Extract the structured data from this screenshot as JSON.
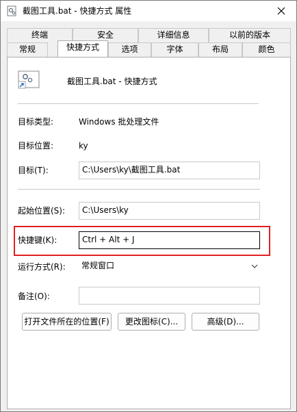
{
  "window": {
    "title": "截图工具.bat - 快捷方式 属性"
  },
  "tabs_row1": [
    "终端",
    "安全",
    "详细信息",
    "以前的版本"
  ],
  "tabs_row2": [
    "常规",
    "快捷方式",
    "选项",
    "字体",
    "布局",
    "颜色"
  ],
  "active_tab": "快捷方式",
  "header": {
    "shortcut_name": "截图工具.bat - 快捷方式"
  },
  "fields": {
    "target_type_label": "目标类型:",
    "target_type_value": "Windows 批处理文件",
    "target_location_label": "目标位置:",
    "target_location_value": "ky",
    "target_label": "目标(T):",
    "target_value": "C:\\Users\\ky\\截图工具.bat",
    "start_in_label": "起始位置(S):",
    "start_in_value": "C:\\Users\\ky",
    "hotkey_label": "快捷键(K):",
    "hotkey_value": "Ctrl + Alt + J",
    "run_label": "运行方式(R):",
    "run_value": "常规窗口",
    "comment_label": "备注(O):",
    "comment_value": ""
  },
  "buttons": {
    "open_location": "打开文件所在的位置(F)",
    "change_icon": "更改图标(C)...",
    "advanced": "高级(D)..."
  },
  "colors": {
    "highlight": "#e02020"
  }
}
